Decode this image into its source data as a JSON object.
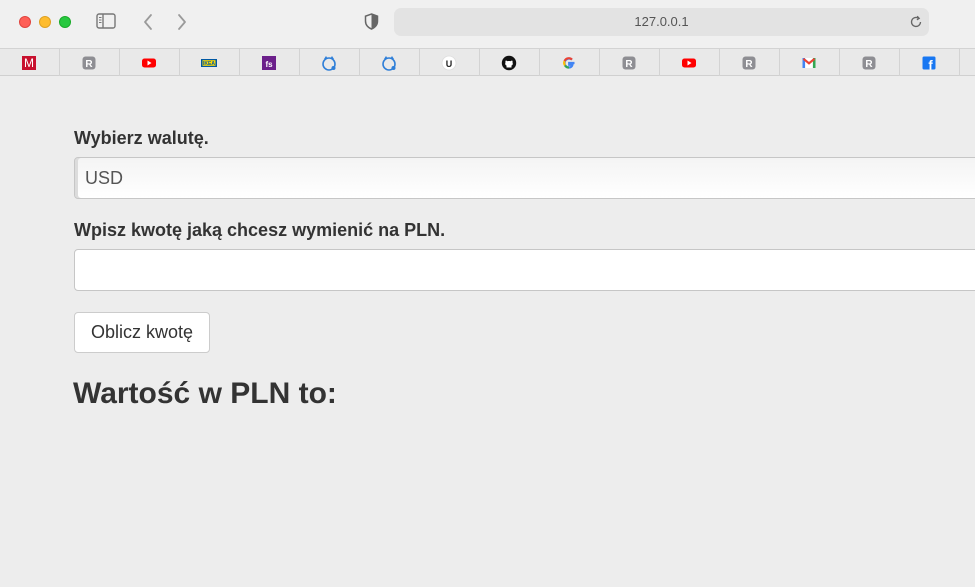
{
  "browser": {
    "url": "127.0.0.1",
    "bookmarks": [
      {
        "icon": "mbank-icon",
        "glyph": "M",
        "color": "#c8102e"
      },
      {
        "icon": "r-bookmark-icon",
        "glyph": "R",
        "color": "#8e8e93"
      },
      {
        "icon": "youtube-icon",
        "glyph": "",
        "color": "#ff0000"
      },
      {
        "icon": "ikea-icon",
        "glyph": "IKEA",
        "color": "#0058a3"
      },
      {
        "icon": "fs-icon",
        "glyph": "fs",
        "color": "#6b1f8a"
      },
      {
        "icon": "cat-globe-icon",
        "glyph": "",
        "color": "#2f7fd8"
      },
      {
        "icon": "cat-globe-icon",
        "glyph": "",
        "color": "#2f7fd8"
      },
      {
        "icon": "u-bookmark-icon",
        "glyph": "U",
        "color": "#222222"
      },
      {
        "icon": "github-icon",
        "glyph": "",
        "color": "#111111"
      },
      {
        "icon": "google-icon",
        "glyph": "G",
        "color": "#4285f4"
      },
      {
        "icon": "r-bookmark-icon",
        "glyph": "R",
        "color": "#8e8e93"
      },
      {
        "icon": "youtube-icon",
        "glyph": "",
        "color": "#ff0000"
      },
      {
        "icon": "r-bookmark-icon",
        "glyph": "R",
        "color": "#8e8e93"
      },
      {
        "icon": "gmail-icon",
        "glyph": "M",
        "color": "#ea4335"
      },
      {
        "icon": "r-bookmark-icon",
        "glyph": "R",
        "color": "#8e8e93"
      },
      {
        "icon": "facebook-icon",
        "glyph": "f",
        "color": "#1877f2"
      }
    ]
  },
  "form": {
    "currency_label": "Wybierz walutę.",
    "currency_value": "USD",
    "amount_label": "Wpisz kwotę jaką chcesz wymienić na PLN.",
    "amount_value": "",
    "submit_label": "Oblicz kwotę",
    "result_text": "Wartość w PLN to:"
  }
}
